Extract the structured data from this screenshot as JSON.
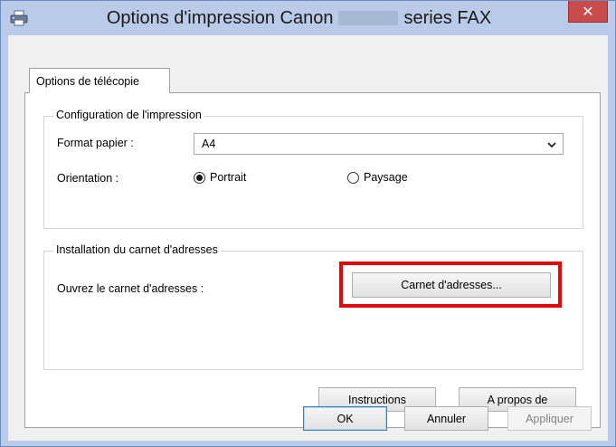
{
  "window": {
    "title_prefix": "Options d'impression Canon",
    "title_suffix": "series FAX",
    "close_label": "✕"
  },
  "tab": {
    "label": "Options de télécopie"
  },
  "print_config": {
    "title": "Configuration de l'impression",
    "paper_label": "Format papier :",
    "paper_value": "A4",
    "orientation_label": "Orientation :",
    "portrait_label": "Portrait",
    "landscape_label": "Paysage",
    "selected_orientation": "Portrait"
  },
  "address_book": {
    "title": "Installation du carnet d'adresses",
    "open_label": "Ouvrez le carnet d'adresses :",
    "button_label": "Carnet d'adresses...",
    "highlight_color": "#e00a0a"
  },
  "panel_buttons": {
    "instructions": "Instructions",
    "about": "A propos de"
  },
  "dialog_buttons": {
    "ok": "OK",
    "cancel": "Annuler",
    "apply": "Appliquer",
    "apply_disabled": true
  },
  "icons": {
    "app": "printer-icon",
    "close": "close-icon",
    "dropdown": "chevron-down-icon"
  }
}
